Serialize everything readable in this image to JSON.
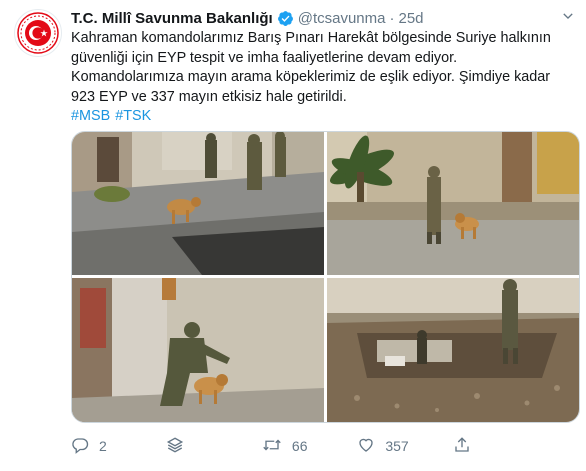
{
  "account": {
    "name": "T.C. Millî Savunma Bakanlığı",
    "handle": "@tcsavunma",
    "separator": "·",
    "time": "25d"
  },
  "tweet": {
    "text_line1": "Kahraman komandolarımız Barış Pınarı Harekât bölgesinde Suriye halkının güvenliği için EYP tespit ve imha faaliyetlerine devam ediyor.",
    "text_line2": "Komandolarımıza mayın arama köpeklerimiz de eşlik ediyor. Şimdiye kadar 923 EYP ve 337 mayın etkisiz hale getirildi.",
    "hashtags": [
      "#MSB",
      "#TSK"
    ]
  },
  "photos": [
    {
      "name": "photo-street-soldiers-dog"
    },
    {
      "name": "photo-palm-soldier-dog"
    },
    {
      "name": "photo-soldier-kneeling-dog"
    },
    {
      "name": "photo-trench-soldier-dog"
    }
  ],
  "actions": {
    "reply_count": "2",
    "retweet_count": "66",
    "like_count": "357"
  },
  "colors": {
    "link": "#1b95e0",
    "muted": "#657786",
    "verified": "#1da1f2",
    "avatar_red": "#e30a17"
  },
  "icons": [
    "reply-icon",
    "stack-icon",
    "retweet-icon",
    "like-icon",
    "share-icon",
    "verified-icon",
    "caret-down-icon"
  ]
}
